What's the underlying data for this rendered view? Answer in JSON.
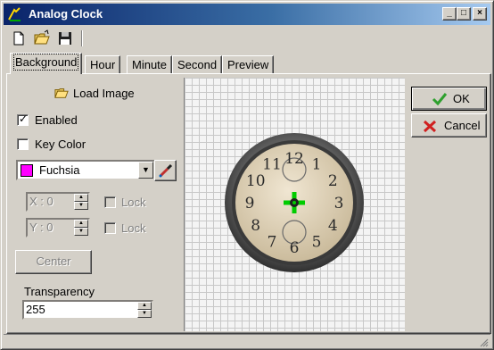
{
  "window": {
    "title": "Analog Clock"
  },
  "caption_buttons": {
    "minimize": "_",
    "maximize": "□",
    "close": "×"
  },
  "toolbar": {
    "items": [
      {
        "name": "new",
        "icon": "new-file-icon"
      },
      {
        "name": "open",
        "icon": "open-folder-icon"
      },
      {
        "name": "save",
        "icon": "save-disk-icon"
      }
    ]
  },
  "tabs": [
    {
      "label": "Background",
      "active": true
    },
    {
      "label": "Hour",
      "active": false
    },
    {
      "label": "Minute",
      "active": false
    },
    {
      "label": "Second",
      "active": false
    },
    {
      "label": "Preview",
      "active": false
    }
  ],
  "background": {
    "load_image_label": "Load Image",
    "enabled_label": "Enabled",
    "enabled_checked": true,
    "key_color_label": "Key Color",
    "key_color_checked": false,
    "color_select": {
      "value": "Fuchsia",
      "swatch": "#ff00ff"
    },
    "x_value": "X : 0",
    "y_value": "Y : 0",
    "lock_label": "Lock",
    "center_label": "Center",
    "transparency_label": "Transparency",
    "transparency_value": "255"
  },
  "clock": {
    "numerals": [
      "12",
      "1",
      "2",
      "3",
      "4",
      "5",
      "6",
      "7",
      "8",
      "9",
      "10",
      "11"
    ],
    "anchor_color": "#00cc00"
  },
  "actions": {
    "ok_label": "OK",
    "cancel_label": "Cancel"
  },
  "colors": {
    "titlebar_start": "#0a246a",
    "titlebar_end": "#a6caf0",
    "ok_check": "#2ea02e",
    "cancel_x": "#d02020"
  }
}
